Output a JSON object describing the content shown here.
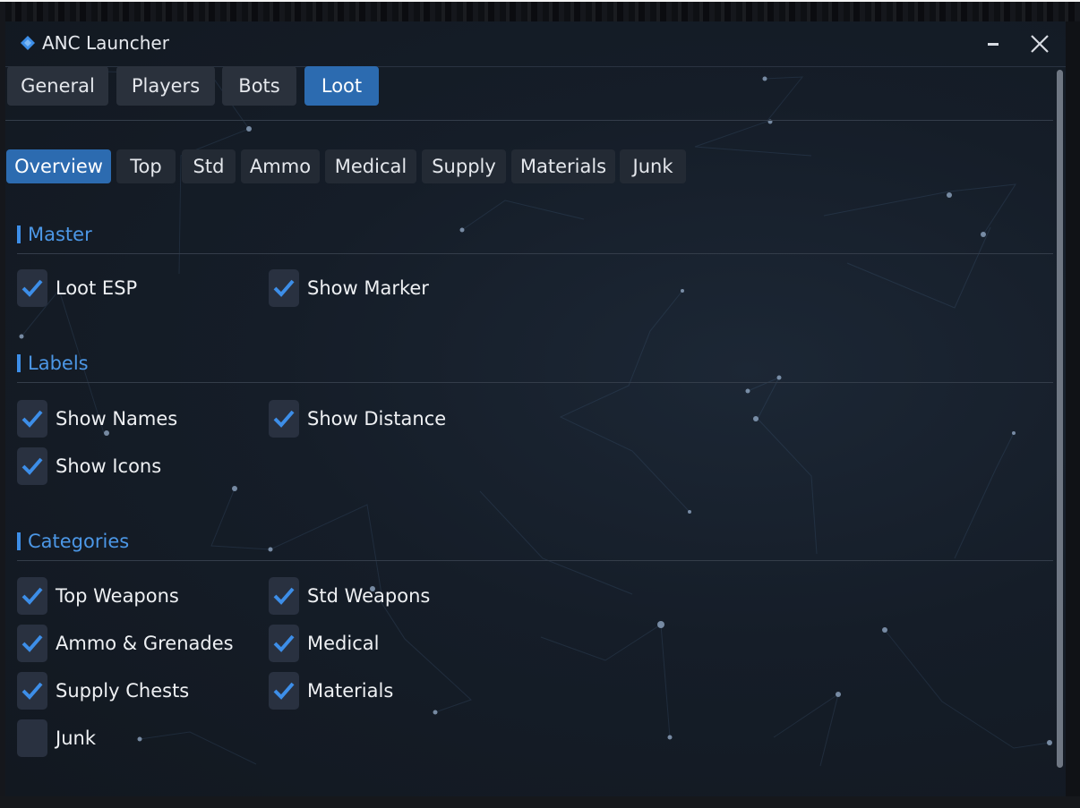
{
  "window": {
    "title": "ANC Launcher",
    "icon": "diamond-logo-icon",
    "controls": {
      "minimize": "minimize-icon",
      "close": "close-icon"
    }
  },
  "main_tabs": [
    {
      "label": "General",
      "active": false
    },
    {
      "label": "Players",
      "active": false
    },
    {
      "label": "Bots",
      "active": false
    },
    {
      "label": "Loot",
      "active": true
    }
  ],
  "sub_tabs": [
    {
      "label": "Overview",
      "active": true
    },
    {
      "label": "Top",
      "active": false
    },
    {
      "label": "Std",
      "active": false
    },
    {
      "label": "Ammo",
      "active": false
    },
    {
      "label": "Medical",
      "active": false
    },
    {
      "label": "Supply",
      "active": false
    },
    {
      "label": "Materials",
      "active": false
    },
    {
      "label": "Junk",
      "active": false
    }
  ],
  "sections": {
    "master": {
      "title": "Master",
      "items": [
        {
          "label": "Loot ESP",
          "checked": true
        },
        {
          "label": "Show Marker",
          "checked": true
        }
      ]
    },
    "labels": {
      "title": "Labels",
      "items": [
        {
          "label": "Show Names",
          "checked": true
        },
        {
          "label": "Show Distance",
          "checked": true
        },
        {
          "label": "Show Icons",
          "checked": true
        }
      ]
    },
    "categories": {
      "title": "Categories",
      "items": [
        {
          "label": "Top Weapons",
          "checked": true
        },
        {
          "label": "Std Weapons",
          "checked": true
        },
        {
          "label": "Ammo & Grenades",
          "checked": true
        },
        {
          "label": "Medical",
          "checked": true
        },
        {
          "label": "Supply Chests",
          "checked": true
        },
        {
          "label": "Materials",
          "checked": true
        },
        {
          "label": "Junk",
          "checked": false
        }
      ]
    }
  },
  "colors": {
    "accent": "#2c6bb0",
    "section_title": "#4c97e6",
    "checkmark": "#3d8ee8",
    "background": "#151d28"
  }
}
